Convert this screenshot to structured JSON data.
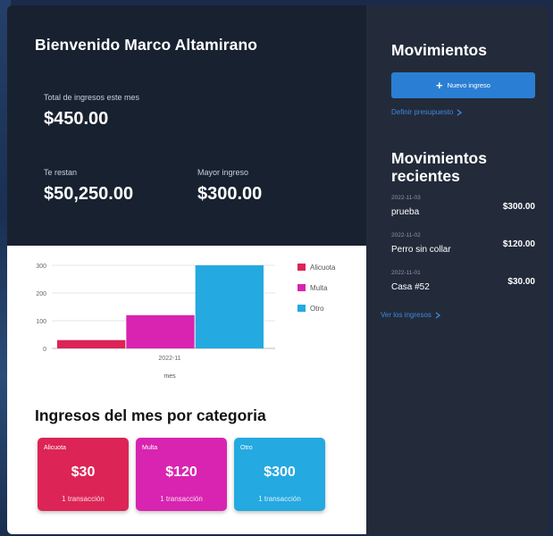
{
  "hero": {
    "welcome": "Bienvenido Marco Altamirano",
    "total_label": "Total de ingresos este mes",
    "total_value": "$450.00",
    "remaining_label": "Te restan",
    "remaining_value": "$50,250.00",
    "max_label": "Mayor ingreso",
    "max_value": "$300.00"
  },
  "chart_data": {
    "type": "bar",
    "categories": [
      "2022-11"
    ],
    "series": [
      {
        "name": "Alicuota",
        "values": [
          30
        ],
        "color": "#dc2456"
      },
      {
        "name": "Multa",
        "values": [
          120
        ],
        "color": "#d824b0"
      },
      {
        "name": "Otro",
        "values": [
          300
        ],
        "color": "#24a9e0"
      }
    ],
    "xlabel": "mes",
    "ylabel": "",
    "ylim": [
      0,
      300
    ],
    "yticks": [
      "0",
      "100",
      "200",
      "300"
    ],
    "grid": true,
    "legend_position": "right"
  },
  "categories_section": {
    "title": "Ingresos del mes por categoria",
    "cards": [
      {
        "name": "Alicuota",
        "amount": "$30",
        "count": "1 transacción",
        "color": "#dc2456"
      },
      {
        "name": "Multa",
        "amount": "$120",
        "count": "1 transacción",
        "color": "#d824b0"
      },
      {
        "name": "Otro",
        "amount": "$300",
        "count": "1 transacción",
        "color": "#24a9e0"
      }
    ]
  },
  "sidebar": {
    "title": "Movimientos",
    "new_button": "Nuevo ingreso",
    "budget_link": "Definir presupuesto",
    "recent_title": "Movimientos recientes",
    "movements": [
      {
        "date": "2022-11-03",
        "name": "prueba",
        "amount": "$300.00"
      },
      {
        "date": "2022-11-02",
        "name": "Perro sin collar",
        "amount": "$120.00"
      },
      {
        "date": "2022-11-01",
        "name": "Casa #52",
        "amount": "$30.00"
      }
    ],
    "view_link": "Ver los ingresos"
  }
}
